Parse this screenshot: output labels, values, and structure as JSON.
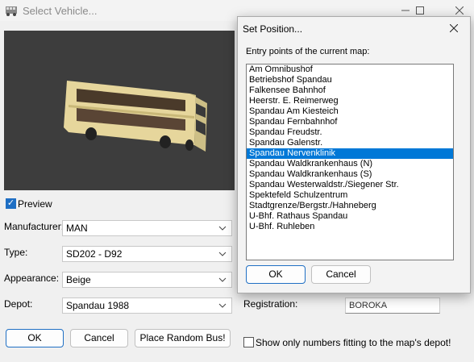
{
  "window": {
    "title": "Select Vehicle..."
  },
  "preview": {
    "label": "Preview",
    "checked": true
  },
  "form": {
    "manufacturer": {
      "label": "Manufacturer:",
      "value": "MAN"
    },
    "type": {
      "label": "Type:",
      "value": "SD202 - D92"
    },
    "appearance": {
      "label": "Appearance:",
      "value": "Beige"
    },
    "depot": {
      "label": "Depot:",
      "value": "Spandau 1988"
    },
    "registration": {
      "label": "Registration:",
      "value": "BOROKA"
    }
  },
  "buttons": {
    "ok": "OK",
    "cancel": "Cancel",
    "random": "Place Random Bus!"
  },
  "filter": {
    "label": "Show only numbers fitting to the map's depot!",
    "checked": false
  },
  "dialog": {
    "title": "Set Position...",
    "prompt": "Entry points of the current map:",
    "ok": "OK",
    "cancel": "Cancel",
    "selected": "Spandau Nervenklinik",
    "items": [
      "Am Omnibushof",
      "Betriebshof Spandau",
      "Falkensee Bahnhof",
      "Heerstr. E. Reimerweg",
      "Spandau Am Kiesteich",
      "Spandau Fernbahnhof",
      "Spandau Freudstr.",
      "Spandau Galenstr.",
      "Spandau Nervenklinik",
      "Spandau Waldkrankenhaus (N)",
      "Spandau Waldkrankenhaus (S)",
      "Spandau Westerwaldstr./Siegener Str.",
      "Spektefeld Schulzentrum",
      "Stadtgrenze/Bergstr./Hahneberg",
      "U-Bhf. Rathaus Spandau",
      "U-Bhf. Ruhleben"
    ]
  },
  "colors": {
    "accent": "#0078d7",
    "bus_body": "#e8d9a0",
    "preview_bg": "#3d3d3d"
  },
  "icons": {
    "app": "bus-app-icon",
    "minimize": "minimize-icon",
    "maximize": "maximize-icon",
    "close": "close-icon",
    "dropdown": "chevron-down-icon"
  }
}
